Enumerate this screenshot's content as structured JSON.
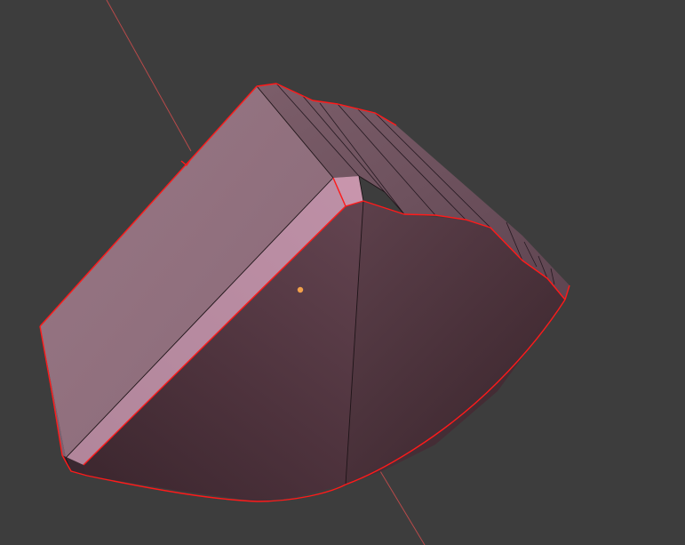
{
  "viewport": {
    "background_color": "#3d3d3d",
    "axis_line_color": "#b84a4a",
    "selection_outline_color": "#ff1a1a",
    "object_origin_color": "#f2a14a",
    "mesh_face_light_color": "#987885",
    "mesh_face_shadow_color": "#3c262d",
    "wire_edge_color": "#1e1418"
  },
  "scene": {
    "object": {
      "selected": true,
      "icon": "mesh-object-icon"
    },
    "origin_marker": {
      "icon": "object-origin-dot-icon"
    },
    "axis": {
      "icon": "axis-line-icon"
    }
  }
}
